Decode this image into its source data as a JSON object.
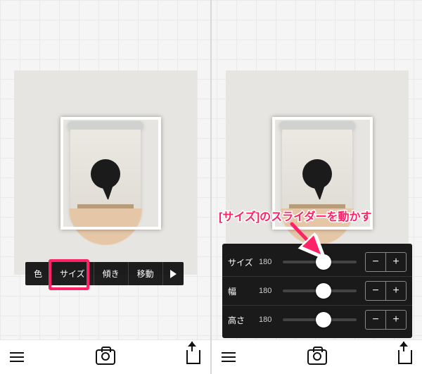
{
  "tabs": {
    "color": "色",
    "size": "サイズ",
    "tilt": "傾き",
    "move": "移動"
  },
  "sliders": [
    {
      "label": "サイズ",
      "value": "180",
      "knob": 0.55
    },
    {
      "label": "幅",
      "value": "180",
      "knob": 0.55
    },
    {
      "label": "高さ",
      "value": "180",
      "knob": 0.55
    }
  ],
  "annotation": "[サイズ]のスライダーを動かす",
  "icons": {
    "minus": "−",
    "plus": "+"
  }
}
